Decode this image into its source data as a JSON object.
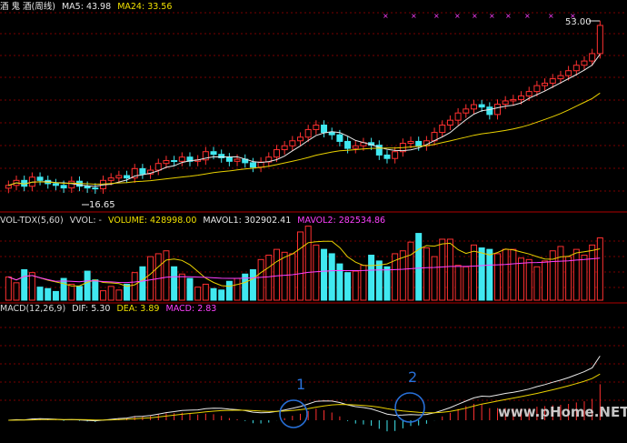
{
  "price_panel": {
    "title": "酒 鬼 酒(周线)",
    "ma5_label": "MA5: 43.98",
    "ma24_label": "MA24: 33.56",
    "high_label": "53.00",
    "low_label": "16.65"
  },
  "volume_panel": {
    "name": "VOL-TDX(5,60)",
    "vvol_label": "VVOL: -",
    "volume_label": "VOLUME: 428998.00",
    "mavol1_label": "MAVOL1: 302902.41",
    "mavol2_label": "MAVOL2: 282534.86"
  },
  "macd_panel": {
    "name": "MACD(12,26,9)",
    "dif_label": "DIF: 5.30",
    "dea_label": "DEA: 3.89",
    "macd_label": "MACD: 2.83",
    "marker_1": "1",
    "marker_2": "2"
  },
  "watermark": "www.pHome.NET",
  "colors": {
    "up": "#ff3030",
    "down": "#40e8f0",
    "ma5": "#e8e8e8",
    "ma24": "#e8d000",
    "magenta": "#ff40ff",
    "grid": "#7a0000",
    "marker": "#2870d8"
  },
  "chart_data": {
    "type": "candlestick",
    "period": "weekly",
    "weeks": 76,
    "closes": [
      16.4,
      17.0,
      16.3,
      17.4,
      17.0,
      16.6,
      16.4,
      16.1,
      16.9,
      16.3,
      16.1,
      16.0,
      17.0,
      17.3,
      17.6,
      17.3,
      18.5,
      17.8,
      18.3,
      19.2,
      19.6,
      19.5,
      20.1,
      19.5,
      19.7,
      20.9,
      20.5,
      20.0,
      19.5,
      19.8,
      19.3,
      18.7,
      19.4,
      20.1,
      21.2,
      21.8,
      22.6,
      23.2,
      24.5,
      25.3,
      24.0,
      23.6,
      22.5,
      21.4,
      21.8,
      22.3,
      21.9,
      20.4,
      19.9,
      20.9,
      22.2,
      22.5,
      21.8,
      22.6,
      24.0,
      25.3,
      26.2,
      27.6,
      28.4,
      29.3,
      28.8,
      27.3,
      29.4,
      30.1,
      30.4,
      31.2,
      32.2,
      33.6,
      34.2,
      35.3,
      36.1,
      37.4,
      38.9,
      40.1,
      42.3,
      51.8
    ],
    "price_low": 16.65,
    "price_high": 53.0,
    "volume": [
      160000,
      120000,
      210000,
      190000,
      90000,
      80000,
      60000,
      150000,
      110000,
      95000,
      200000,
      140000,
      65000,
      95000,
      70000,
      110000,
      190000,
      230000,
      300000,
      320000,
      340000,
      230000,
      180000,
      150000,
      90000,
      110000,
      80000,
      70000,
      130000,
      150000,
      180000,
      210000,
      280000,
      310000,
      350000,
      330000,
      320000,
      470000,
      510000,
      380000,
      350000,
      320000,
      250000,
      190000,
      200000,
      240000,
      310000,
      270000,
      230000,
      320000,
      340000,
      400000,
      460000,
      360000,
      300000,
      420000,
      420000,
      240000,
      230000,
      380000,
      360000,
      350000,
      320000,
      350000,
      350000,
      290000,
      280000,
      230000,
      270000,
      340000,
      370000,
      300000,
      350000,
      310000,
      380000,
      428998
    ],
    "mavol1": 302902.41,
    "mavol2": 282534.86,
    "dif": 5.3,
    "dea": 3.89,
    "macd": 2.83
  }
}
